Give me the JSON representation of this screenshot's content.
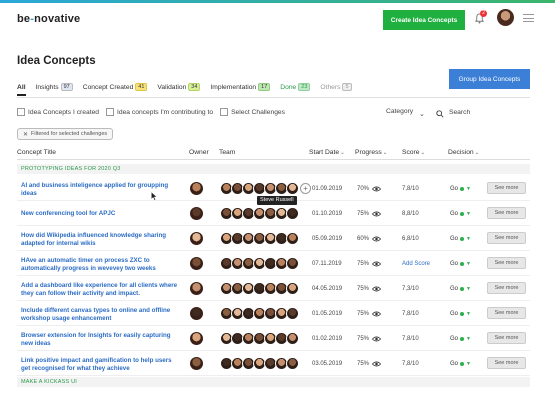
{
  "app": {
    "logo_a": "be",
    "logo_b": "novative"
  },
  "header": {
    "create_button": "Create Idea Concepts",
    "notification_count": "2"
  },
  "page": {
    "title": "Idea Concepts",
    "group_button": "Group Idea Concepts"
  },
  "tabs": [
    {
      "label": "All",
      "count": ""
    },
    {
      "label": "Insights",
      "count": "97"
    },
    {
      "label": "Concept Created",
      "count": "41"
    },
    {
      "label": "Validation",
      "count": "34"
    },
    {
      "label": "Implementation",
      "count": "17"
    },
    {
      "label": "Done",
      "count": "23"
    },
    {
      "label": "Others",
      "count": "5"
    }
  ],
  "filters": {
    "created": "Idea Concepts I created",
    "contributing": "Idea concepts I'm contributing to",
    "select": "Select Challenges",
    "category": "Category",
    "search": "Search",
    "chip": "Filtered for selected challenges"
  },
  "columns": {
    "title": "Concept Title",
    "owner": "Owner",
    "team": "Team",
    "start": "Start Date",
    "progress": "Progress",
    "score": "Score",
    "decision": "Decision"
  },
  "groups": [
    "PROTOTYPING IDEAS FOR 2020 Q3",
    "MAKE A KICKASS UI"
  ],
  "rows": [
    {
      "title": "AI and business inteligence applied for groupping ideas",
      "date": "01.09.2019",
      "progress": "70%",
      "score": "7,8/10",
      "decision": "Go"
    },
    {
      "title": "New conferencing tool for APJC",
      "date": "01.10.2019",
      "progress": "75%",
      "score": "8,8/10",
      "decision": "Go"
    },
    {
      "title": "How did Wikipedia influenced knowledge sharing adapted for internal wikis",
      "date": "05.09.2019",
      "progress": "60%",
      "score": "6,8/10",
      "decision": "Go"
    },
    {
      "title": "HAve an automatic timer on process ZXC to automatically progress in wevevey two weeks",
      "date": "07.11.2019",
      "progress": "75%",
      "score": "Add Score",
      "decision": "Go"
    },
    {
      "title": "Add a dashboard like experience for all clients where they can follow their activity and impact.",
      "date": "04.05.2019",
      "progress": "75%",
      "score": "7,3/10",
      "decision": "Go"
    },
    {
      "title": "Include different canvas types to online and offline workshop usage enhancement",
      "date": "01.05.2019",
      "progress": "75%",
      "score": "7,8/10",
      "decision": "Go"
    },
    {
      "title": "Browser extension for Insights for easily capturing new ideas",
      "date": "01.02.2019",
      "progress": "75%",
      "score": "7,8/10",
      "decision": "Go"
    },
    {
      "title": "Link positive impact and gamification to help users get recognised for what they achieve",
      "date": "03.05.2019",
      "progress": "75%",
      "score": "7,8/10",
      "decision": "Go"
    }
  ],
  "see_more": "See more",
  "tooltip": "Steve Russell",
  "colors": {
    "green": "#20b040",
    "blue": "#3b7fd6",
    "link": "#2b6cc4"
  }
}
